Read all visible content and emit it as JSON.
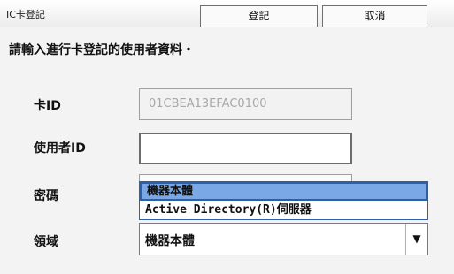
{
  "header": {
    "title": "IC卡登記",
    "register_label": "登記",
    "cancel_label": "取消"
  },
  "instruction": "請輸入進行卡登記的使用者資料・",
  "fields": {
    "card_id": {
      "label": "卡ID",
      "value": "01CBEA13EFAC0100"
    },
    "user_id": {
      "label": "使用者ID",
      "value": ""
    },
    "password": {
      "label": "密碼",
      "value": ""
    },
    "domain": {
      "label": "領域",
      "value": "機器本體"
    }
  },
  "dropdown_options": [
    "機器本體",
    "Active Directory(R)伺服器"
  ],
  "colors": {
    "selected_option": "#7aa7e6",
    "popup_border": "#2e5fa8"
  }
}
